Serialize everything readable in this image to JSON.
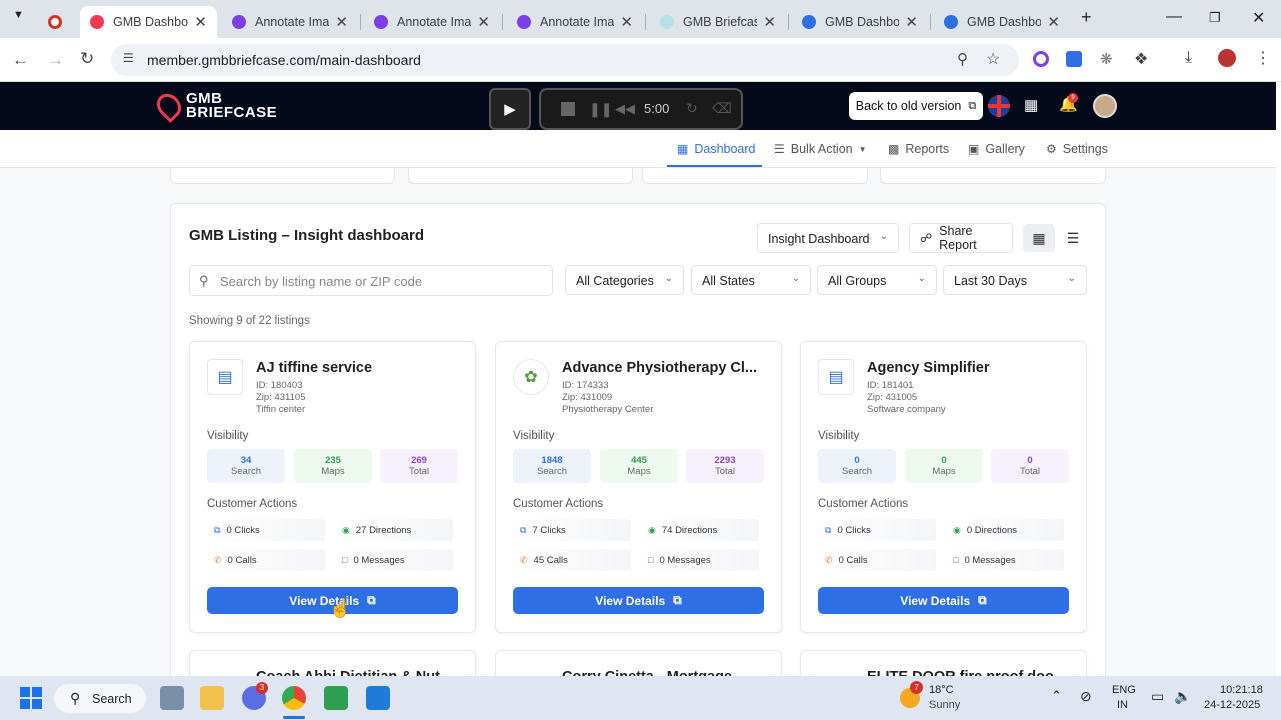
{
  "browser": {
    "tabs": [
      {
        "title": "",
        "favicon_color": "#d93025"
      },
      {
        "title": "GMB Dashboard",
        "favicon_color": "#f13a52"
      },
      {
        "title": "Annotate Images",
        "favicon_color": "#7b3fe4"
      },
      {
        "title": "Annotate Images",
        "favicon_color": "#7b3fe4"
      },
      {
        "title": "Annotate Images",
        "favicon_color": "#7b3fe4"
      },
      {
        "title": "GMB Briefcase",
        "favicon_color": "#b8e0e8"
      },
      {
        "title": "GMB Dashboard",
        "favicon_color": "#2f6fe4"
      },
      {
        "title": "GMB Dashboard",
        "favicon_color": "#2f6fe4"
      }
    ],
    "url": "member.gmbbriefcase.com/main-dashboard"
  },
  "app": {
    "logo_line1": "GMB",
    "logo_line2": "BRIEFCASE",
    "timer": "5:00",
    "back_old_version": "Back to old version",
    "notification_count": "9"
  },
  "nav": {
    "items": [
      "Dashboard",
      "Bulk Action",
      "Reports",
      "Gallery",
      "Settings"
    ]
  },
  "panel": {
    "title": "GMB Listing – Insight dashboard",
    "dashboard_select": "Insight Dashboard",
    "share_report": "Share Report",
    "search_placeholder": "Search by listing name or ZIP code",
    "filters": [
      "All Categories",
      "All States",
      "All Groups",
      "Last 30 Days"
    ],
    "showing": "Showing 9 of 22 listings",
    "visibility_label": "Visibility",
    "customer_actions_label": "Customer Actions",
    "view_details": "View Details",
    "search_label": "Search",
    "maps_label": "Maps",
    "total_label": "Total"
  },
  "listings": [
    {
      "name": "AJ tiffine service",
      "id": "ID: 180403",
      "zip": "Zip: 431105",
      "category": "Tiffin center",
      "search": "34",
      "maps": "235",
      "total": "269",
      "clicks": "0 Clicks",
      "directions": "27 Directions",
      "calls": "0 Calls",
      "messages": "0 Messages"
    },
    {
      "name": "Advance Physiotherapy Cl...",
      "id": "ID: 174333",
      "zip": "Zip: 431009",
      "category": "Physiotherapy Center",
      "search": "1848",
      "maps": "445",
      "total": "2293",
      "clicks": "7 Clicks",
      "directions": "74 Directions",
      "calls": "45 Calls",
      "messages": "0 Messages"
    },
    {
      "name": "Agency Simplifier",
      "id": "ID: 181401",
      "zip": "Zip: 431005",
      "category": "Software company",
      "search": "0",
      "maps": "0",
      "total": "0",
      "clicks": "0 Clicks",
      "directions": "0 Directions",
      "calls": "0 Calls",
      "messages": "0 Messages"
    }
  ],
  "listings_row2": [
    "Coach Abhi Dietitian & Nut...",
    "Corry Cinetta - Mortgage...",
    "ELITE DOOR fire proof doo..."
  ],
  "taskbar": {
    "search": "Search",
    "chat_badge": "3",
    "weather_badge": "7",
    "temp": "18°C",
    "weather": "Sunny",
    "lang1": "ENG",
    "lang2": "IN",
    "time": "10:21:18",
    "date": "24-12-2025"
  },
  "colors": {
    "accent": "#2f6fe4",
    "header": "#050a1a",
    "brand": "#f13a52"
  }
}
